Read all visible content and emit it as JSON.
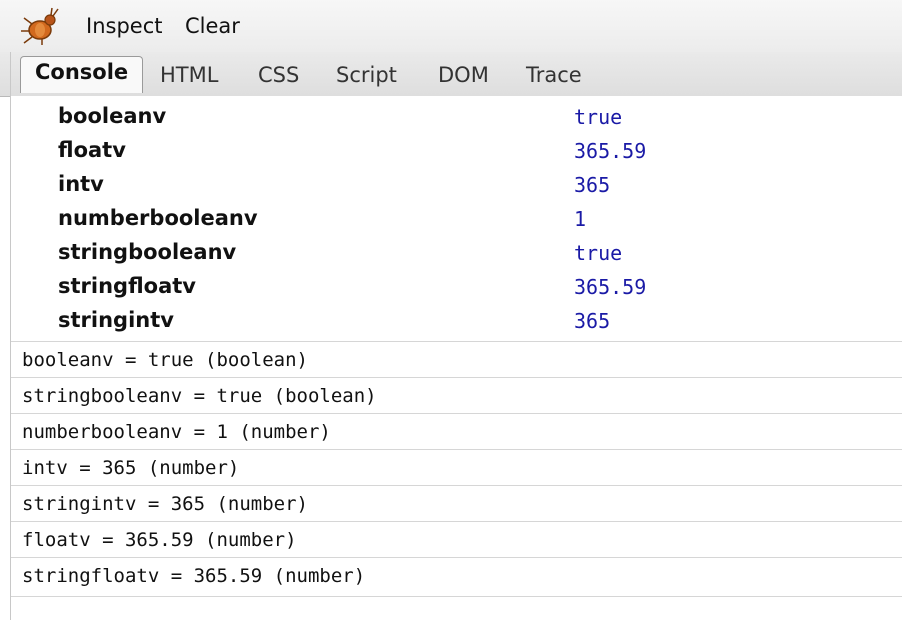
{
  "toolbar": {
    "inspect_label": "Inspect",
    "clear_label": "Clear",
    "logo_icon": "firebug-icon"
  },
  "tabs": [
    {
      "label": "Console",
      "active": true
    },
    {
      "label": "HTML",
      "active": false
    },
    {
      "label": "CSS",
      "active": false
    },
    {
      "label": "Script",
      "active": false
    },
    {
      "label": "DOM",
      "active": false
    },
    {
      "label": "Trace",
      "active": false
    }
  ],
  "object_props": [
    {
      "name": "booleanv",
      "value": "true"
    },
    {
      "name": "floatv",
      "value": "365.59"
    },
    {
      "name": "intv",
      "value": "365"
    },
    {
      "name": "numberbooleanv",
      "value": "1"
    },
    {
      "name": "stringbooleanv",
      "value": "true"
    },
    {
      "name": "stringfloatv",
      "value": "365.59"
    },
    {
      "name": "stringintv",
      "value": "365"
    }
  ],
  "log_lines": [
    "booleanv = true (boolean)",
    "stringbooleanv = true (boolean)",
    "numberbooleanv = 1 (number)",
    "intv = 365 (number)",
    "stringintv = 365 (number)",
    "floatv = 365.59 (number)",
    "stringfloatv = 365.59 (number)"
  ],
  "colors": {
    "value_color": "#1a1aa6",
    "toolbar_bg": "#f2f2f2",
    "tab_bg": "#e4e4e4"
  }
}
